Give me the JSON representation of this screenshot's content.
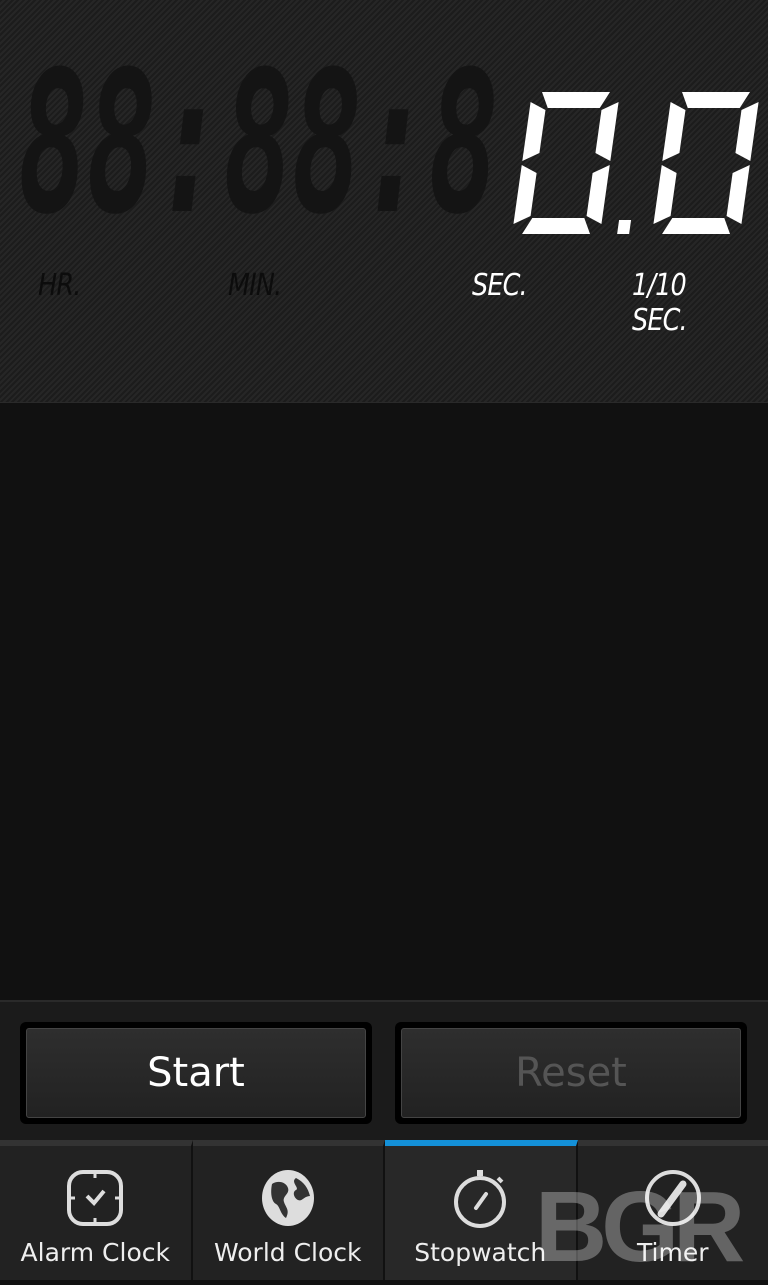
{
  "display": {
    "dim_pattern": "88:88:8",
    "seconds": "0",
    "tenths": "0",
    "units": {
      "hr": "HR.",
      "min": "MIN.",
      "sec": "SEC.",
      "tenth": "1/10 SEC."
    },
    "lit_color": "#ffffff",
    "dim_color": "#141414"
  },
  "buttons": {
    "start": "Start",
    "reset": "Reset"
  },
  "tabs": [
    {
      "label": "Alarm Clock",
      "icon": "alarm-clock-icon"
    },
    {
      "label": "World Clock",
      "icon": "globe-icon"
    },
    {
      "label": "Stopwatch",
      "icon": "stopwatch-icon",
      "active": true
    },
    {
      "label": "Timer",
      "icon": "timer-icon"
    }
  ],
  "accent_color": "#1490d8",
  "watermark": "BGR"
}
